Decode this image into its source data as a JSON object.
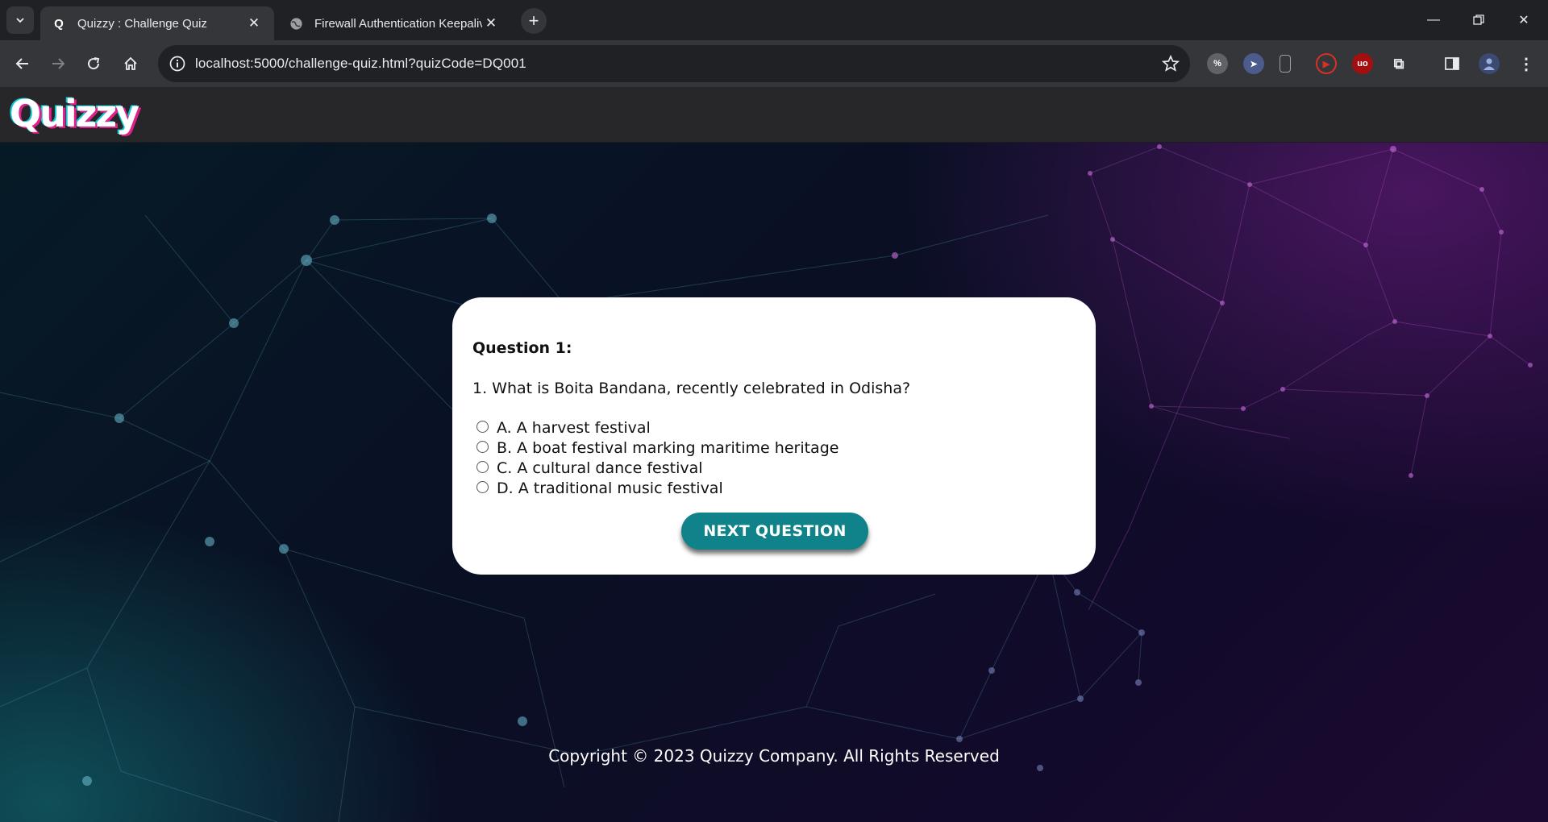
{
  "browser": {
    "tabs": [
      {
        "title": "Quizzy : Challenge Quiz",
        "favicon": "Q",
        "active": true
      },
      {
        "title": "Firewall Authentication Keepalive",
        "favicon": "globe-icon",
        "active": false
      }
    ],
    "url": "localhost:5000/challenge-quiz.html?quizCode=DQ001"
  },
  "header": {
    "logo": "Quizzy"
  },
  "quiz": {
    "question_label": "Question 1:",
    "question_text": "1. What is Boita Bandana, recently celebrated in Odisha?",
    "options": [
      {
        "label": "A. A harvest festival"
      },
      {
        "label": "B. A boat festival marking maritime heritage"
      },
      {
        "label": "C. A cultural dance festival"
      },
      {
        "label": "D. A traditional music festival"
      }
    ],
    "next_button": "NEXT QUESTION"
  },
  "footer": {
    "copyright": "Copyright © 2023 Quizzy Company. All Rights Reserved"
  },
  "colors": {
    "accent": "#0f8389",
    "chrome_dark": "#202124",
    "chrome_toolbar": "#35363a"
  }
}
